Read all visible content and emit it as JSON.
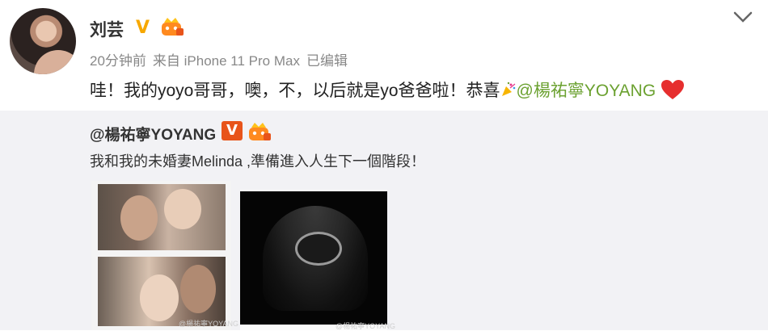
{
  "post": {
    "author": "刘芸",
    "verified_mark": "V",
    "meta": {
      "time": "20分钟前",
      "source": "来自 iPhone 11 Pro Max",
      "edited": "已编辑"
    },
    "text_before": "哇！我的yoyo哥哥，噢，不，以后就是yo爸爸啦！恭喜",
    "mention": "@楊祐寧YOYANG"
  },
  "repost": {
    "author": "@楊祐寧YOYANG",
    "verified_mark": "V",
    "text": "我和我的未婚妻Melinda ,準備進入人生下一個階段！",
    "images": [
      {
        "name": "couple-photo-strip",
        "watermark": "@楊祐寧YOYANG"
      },
      {
        "name": "ultrasound-photo",
        "watermark": "@楊祐寧YOYANG"
      }
    ]
  },
  "colors": {
    "mention": "#6ba130",
    "verified": "#f7a800",
    "repost_bg": "#f2f2f5",
    "heart": "#e62e2e"
  }
}
